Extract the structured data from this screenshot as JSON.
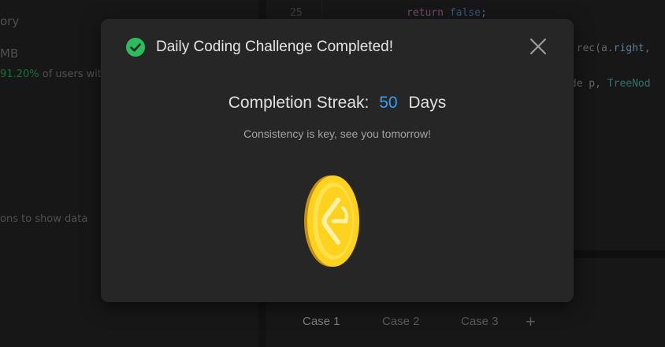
{
  "left_panel": {
    "partial_heading": "ory",
    "partial_memory": "MB",
    "beats_percent": "91.20%",
    "beats_suffix": "of users wit",
    "chart_hint": "ons to show data"
  },
  "editor": {
    "line_number": "25",
    "line_25_kw": "return",
    "line_25_lit": "false",
    "line_25_end": ";",
    "line_b_pre": "& rec(a.",
    "line_b_prop": "right",
    "line_b_end": ",",
    "line_c_pre": "ode p, ",
    "line_c_type": "TreeNod"
  },
  "testcase_tabs": [
    {
      "label": "Case 1",
      "active": true
    },
    {
      "label": "Case 2",
      "active": false
    },
    {
      "label": "Case 3",
      "active": false
    }
  ],
  "add_case_label": "+",
  "modal": {
    "title": "Daily Coding Challenge Completed!",
    "streak_label": "Completion Streak:",
    "streak_value": "50",
    "streak_unit": "Days",
    "subtitle": "Consistency is key, see you tomorrow!"
  },
  "colors": {
    "success_green": "#2cbb5d",
    "streak_blue": "#3c9cf0",
    "coin_gold": "#f5c518"
  },
  "icons": [
    "check-circle-icon",
    "close-icon",
    "coin-icon"
  ]
}
